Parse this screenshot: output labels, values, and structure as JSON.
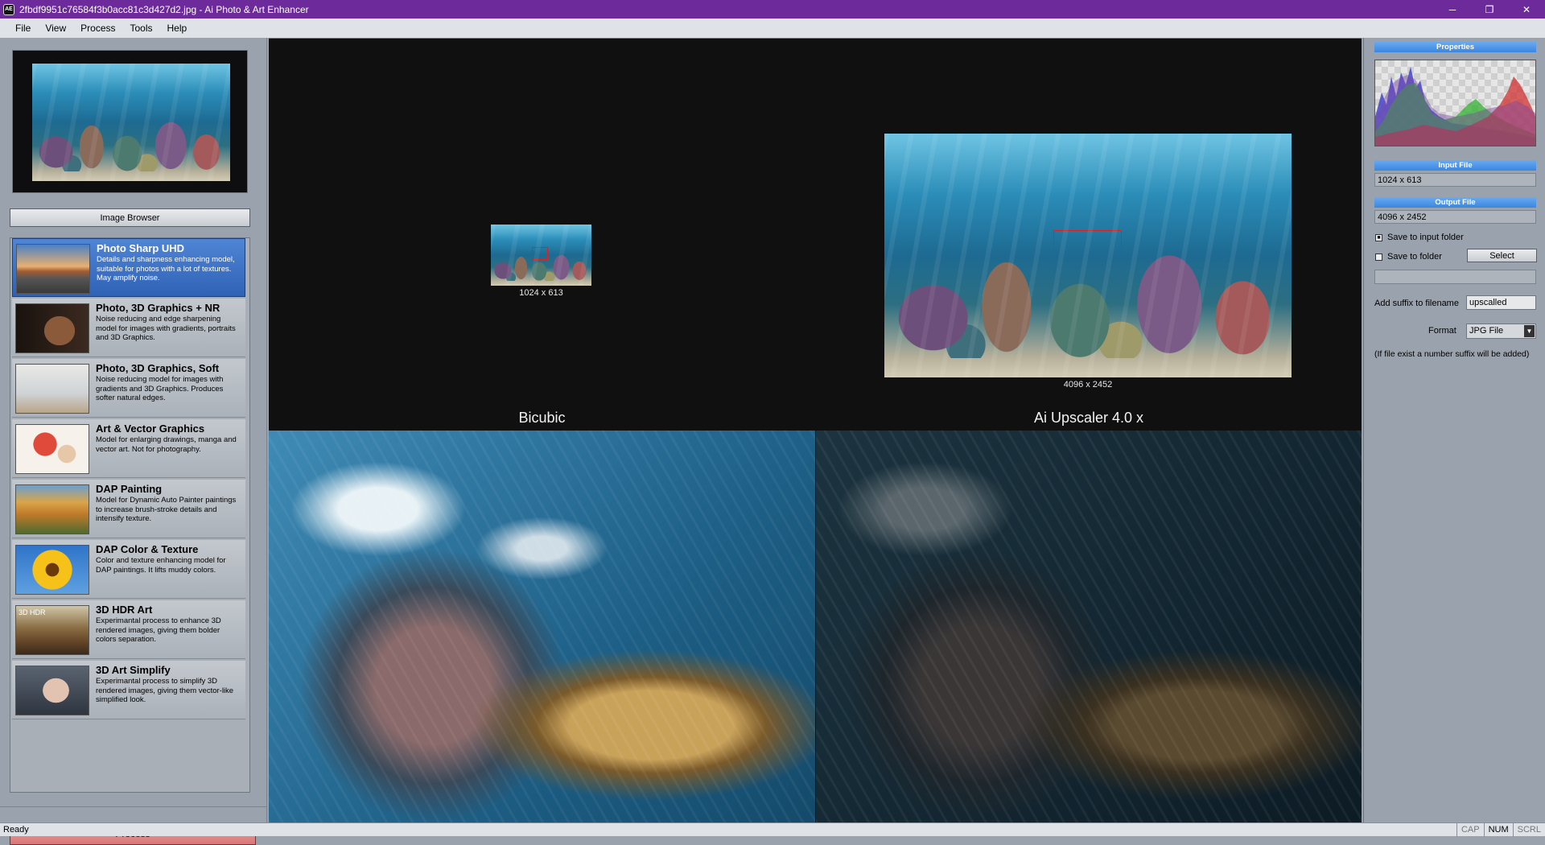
{
  "window": {
    "title": "2fbdf9951c76584f3b0acc81c3d427d2.jpg - Ai Photo & Art Enhancer",
    "icon_text": "AE",
    "minimize": "─",
    "restore": "❐",
    "close": "✕"
  },
  "menu": [
    "File",
    "View",
    "Process",
    "Tools",
    "Help"
  ],
  "left": {
    "image_browser_label": "Image Browser",
    "models": [
      {
        "name": "Photo Sharp UHD",
        "desc": "Details and sharpness enhancing model, suitable for photos with a lot of textures. May amplify noise.",
        "selected": true
      },
      {
        "name": "Photo, 3D Graphics + NR",
        "desc": "Noise reducing and edge sharpening model for images with gradients, portraits and 3D Graphics."
      },
      {
        "name": "Photo, 3D Graphics, Soft",
        "desc": "Noise reducing model for images with gradients and 3D Graphics. Produces softer natural edges."
      },
      {
        "name": "Art & Vector Graphics",
        "desc": "Model for enlarging drawings, manga and vector art. Not for photography."
      },
      {
        "name": "DAP Painting",
        "desc": "Model for Dynamic Auto Painter paintings to increase brush-stroke details and intensify texture."
      },
      {
        "name": "DAP Color & Texture",
        "desc": "Color and texture enhancing model for DAP paintings. It lifts muddy colors."
      },
      {
        "name": "3D HDR Art",
        "desc": "Experimantal process to enhance 3D rendered images, giving them bolder colors separation.",
        "thumb_label": "3D HDR"
      },
      {
        "name": "3D Art Simplify",
        "desc": "Experimantal process to simplify 3D rendered images, giving them vector-like simplified look."
      }
    ],
    "process_label": "Process"
  },
  "center": {
    "input_dims": "1024 x 613",
    "output_dims": "4096 x 2452",
    "left_view_label": "Bicubic",
    "right_view_label": "Ai Upscaler 4.0 x"
  },
  "right": {
    "properties_header": "Properties",
    "input_file_header": "Input File",
    "input_file_value": "1024 x 613",
    "output_file_header": "Output File",
    "output_file_value": "4096 x 2452",
    "save_input_folder_label": "Save to input folder",
    "save_input_folder_checked": true,
    "save_to_folder_label": "Save to folder",
    "save_to_folder_checked": false,
    "select_label": "Select",
    "folder_path": "",
    "suffix_label": "Add suffix to filename",
    "suffix_value": "upscalled",
    "format_label": "Format",
    "format_value": "JPG File",
    "note": "(If file exist a number suffix will be added)"
  },
  "status": {
    "text": "Ready",
    "cap": "CAP",
    "num": "NUM",
    "scrl": "SCRL"
  },
  "colors": {
    "titlebar": "#6c2a9a",
    "selected_model": "#3a6fc2",
    "process_button": "#e08888",
    "section_header": "#4a92e6"
  }
}
